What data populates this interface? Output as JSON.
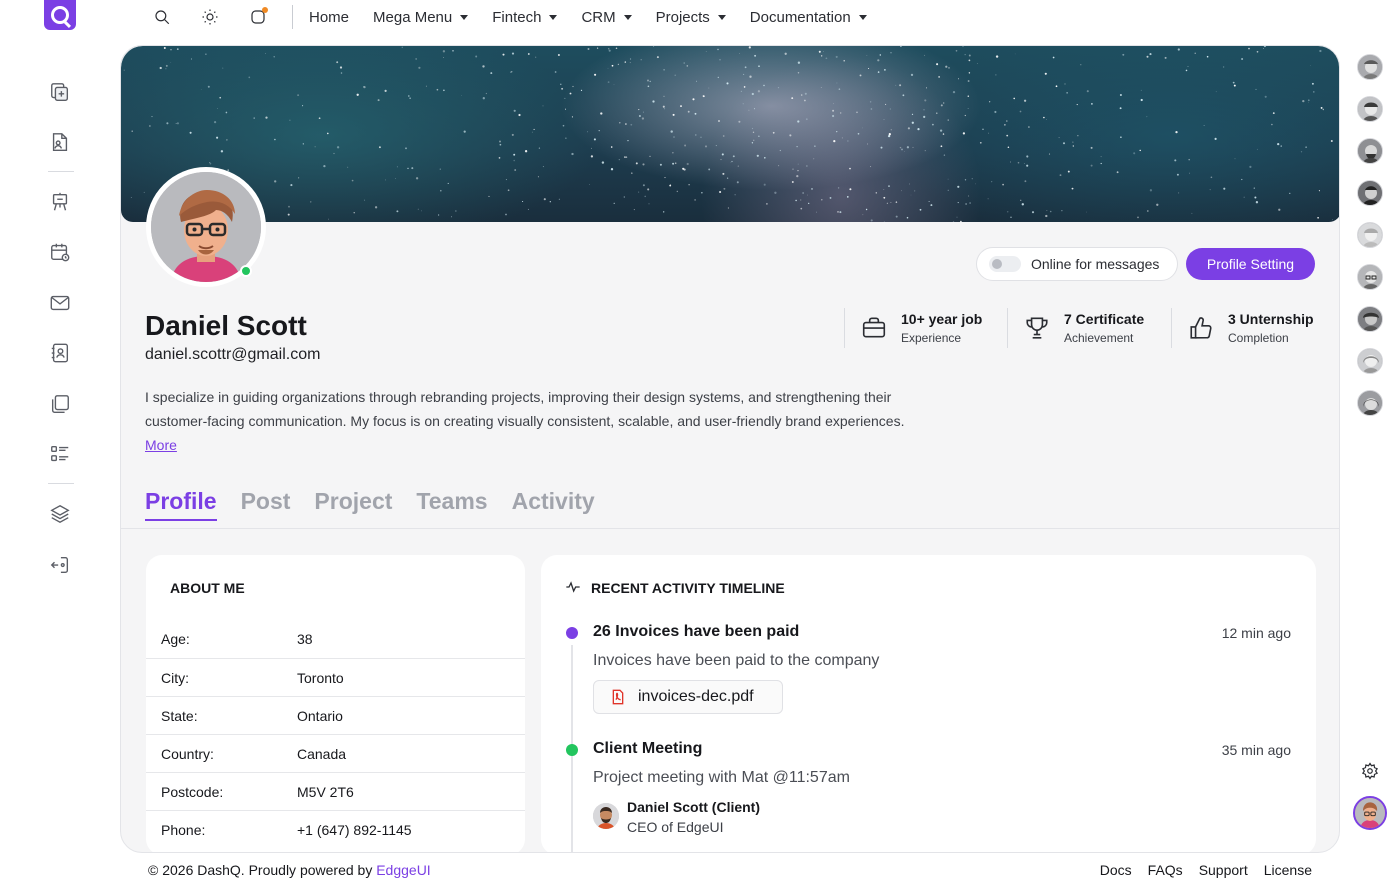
{
  "nav": {
    "items": [
      {
        "label": "Home",
        "dropdown": false
      },
      {
        "label": "Mega Menu",
        "dropdown": true
      },
      {
        "label": "Fintech",
        "dropdown": true
      },
      {
        "label": "CRM",
        "dropdown": true
      },
      {
        "label": "Projects",
        "dropdown": true
      },
      {
        "label": "Documentation",
        "dropdown": true
      }
    ],
    "icons": [
      "search-icon",
      "sun-icon",
      "notification-icon"
    ]
  },
  "sidebar": {
    "icons": [
      "add-page-icon",
      "document-user-icon",
      "presentation-icon",
      "calendar-icon",
      "mail-icon",
      "contacts-icon",
      "files-icon",
      "list-icon",
      "layers-icon",
      "logout-icon"
    ]
  },
  "profile": {
    "name": "Daniel Scott",
    "email": "daniel.scottr@gmail.com",
    "bio": "I specialize in guiding organizations through rebranding projects, improving their design systems, and strengthening their customer-facing communication. My focus is on creating visually consistent, scalable, and user-friendly brand experiences.",
    "more_link": "More",
    "online_toggle_label": "Online for messages",
    "online_toggle_on": false,
    "settings_button": "Profile Setting",
    "status": "online"
  },
  "stats": [
    {
      "title": "10+ year job",
      "subtitle": "Experience",
      "icon": "briefcase-icon"
    },
    {
      "title": "7 Certificate",
      "subtitle": "Achievement",
      "icon": "trophy-icon"
    },
    {
      "title": "3 Unternship",
      "subtitle": "Completion",
      "icon": "thumbs-up-icon"
    }
  ],
  "tabs": [
    {
      "label": "Profile",
      "active": true
    },
    {
      "label": "Post",
      "active": false
    },
    {
      "label": "Project",
      "active": false
    },
    {
      "label": "Teams",
      "active": false
    },
    {
      "label": "Activity",
      "active": false
    }
  ],
  "about": {
    "title": "ABOUT ME",
    "rows": [
      {
        "label": "Age:",
        "value": "38"
      },
      {
        "label": "City:",
        "value": "Toronto"
      },
      {
        "label": "State:",
        "value": "Ontario"
      },
      {
        "label": "Country:",
        "value": "Canada"
      },
      {
        "label": "Postcode:",
        "value": "M5V 2T6"
      },
      {
        "label": "Phone:",
        "value": "+1 (647) 892-1145"
      }
    ]
  },
  "activity": {
    "title": "RECENT ACTIVITY TIMELINE",
    "items": [
      {
        "title": "26 Invoices have been paid",
        "time": "12 min ago",
        "description": "Invoices have been paid to the company",
        "attachment": "invoices-dec.pdf",
        "dot_color": "#7b3fe4"
      },
      {
        "title": "Client Meeting",
        "time": "35 min ago",
        "description": "Project meeting with Mat @11:57am",
        "person_name": "Daniel Scott (Client)",
        "person_role": "CEO of EdgeUI",
        "dot_color": "#22c55e"
      }
    ]
  },
  "footer": {
    "copyright": "© 2026 DashQ. Proudly powered by",
    "brand": "EdggeUI",
    "links": [
      "Docs",
      "FAQs",
      "Support",
      "License"
    ]
  },
  "colors": {
    "accent": "#7b3fe4",
    "online": "#22c55e",
    "notification": "#f08a24"
  }
}
